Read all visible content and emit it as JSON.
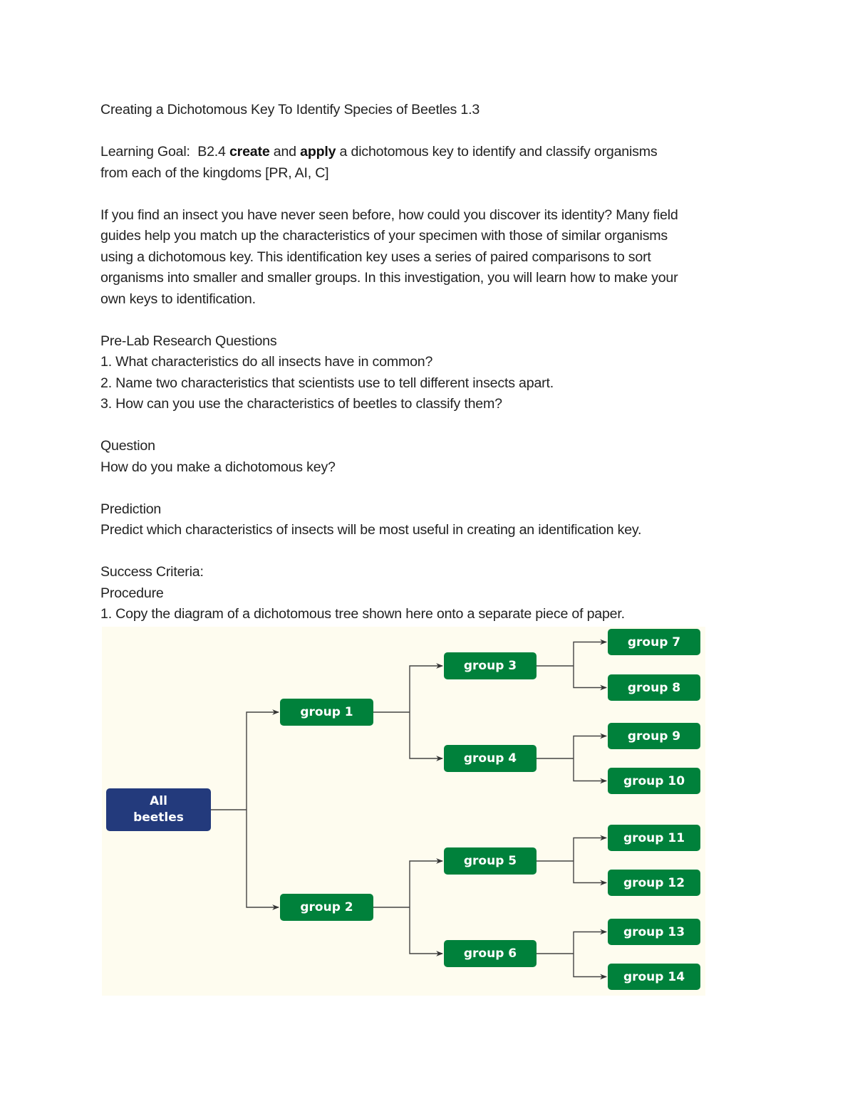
{
  "title": "Creating a Dichotomous Key To Identify Species of Beetles 1.3",
  "learning_goal": {
    "prefix": "Learning Goal:  B2.4 ",
    "bold1": "create",
    "mid": " and ",
    "bold2": "apply",
    "suffix": " a dichotomous key to identify and classify organisms",
    "line2": "from each of the kingdoms [PR, AI, C]"
  },
  "intro_lines": [
    "If you find an insect you have never seen before, how could you discover its identity? Many field",
    "guides help you match up the characteristics of your specimen with those of similar organisms",
    "using a dichotomous key. This identification key uses a series of paired comparisons to sort",
    "organisms into smaller and smaller groups. In this investigation, you will learn how to make your",
    "own keys to identification."
  ],
  "prelab": {
    "heading": "Pre-Lab Research Questions",
    "questions": [
      "1. What characteristics do all insects have in common?",
      "2. Name two characteristics that scientists use to tell different insects apart.",
      "3. How can you use the characteristics of beetles to classify them?"
    ]
  },
  "question": {
    "heading": "Question",
    "text": "How do you make a dichotomous key?"
  },
  "prediction": {
    "heading": "Prediction",
    "text": "Predict which characteristics of insects will be most useful in creating an identification key."
  },
  "success_criteria": "Success Criteria:",
  "procedure": {
    "heading": "Procedure",
    "steps": [
      "1. Copy the diagram of a dichotomous tree shown here onto a separate piece of paper."
    ]
  },
  "diagram": {
    "colors": {
      "root": "#233a7c",
      "group": "#00813b",
      "background": "#fefcef",
      "line": "#444444"
    },
    "root": {
      "line1": "All",
      "line2": "beetles"
    },
    "groups": [
      "group 1",
      "group 2",
      "group 3",
      "group 4",
      "group 5",
      "group 6",
      "group 7",
      "group 8",
      "group 9",
      "group 10",
      "group 11",
      "group 12",
      "group 13",
      "group 14"
    ],
    "edges": [
      [
        "root",
        "group 1"
      ],
      [
        "root",
        "group 2"
      ],
      [
        "group 1",
        "group 3"
      ],
      [
        "group 1",
        "group 4"
      ],
      [
        "group 2",
        "group 5"
      ],
      [
        "group 2",
        "group 6"
      ],
      [
        "group 3",
        "group 7"
      ],
      [
        "group 3",
        "group 8"
      ],
      [
        "group 4",
        "group 9"
      ],
      [
        "group 4",
        "group 10"
      ],
      [
        "group 5",
        "group 11"
      ],
      [
        "group 5",
        "group 12"
      ],
      [
        "group 6",
        "group 13"
      ],
      [
        "group 6",
        "group 14"
      ]
    ]
  }
}
